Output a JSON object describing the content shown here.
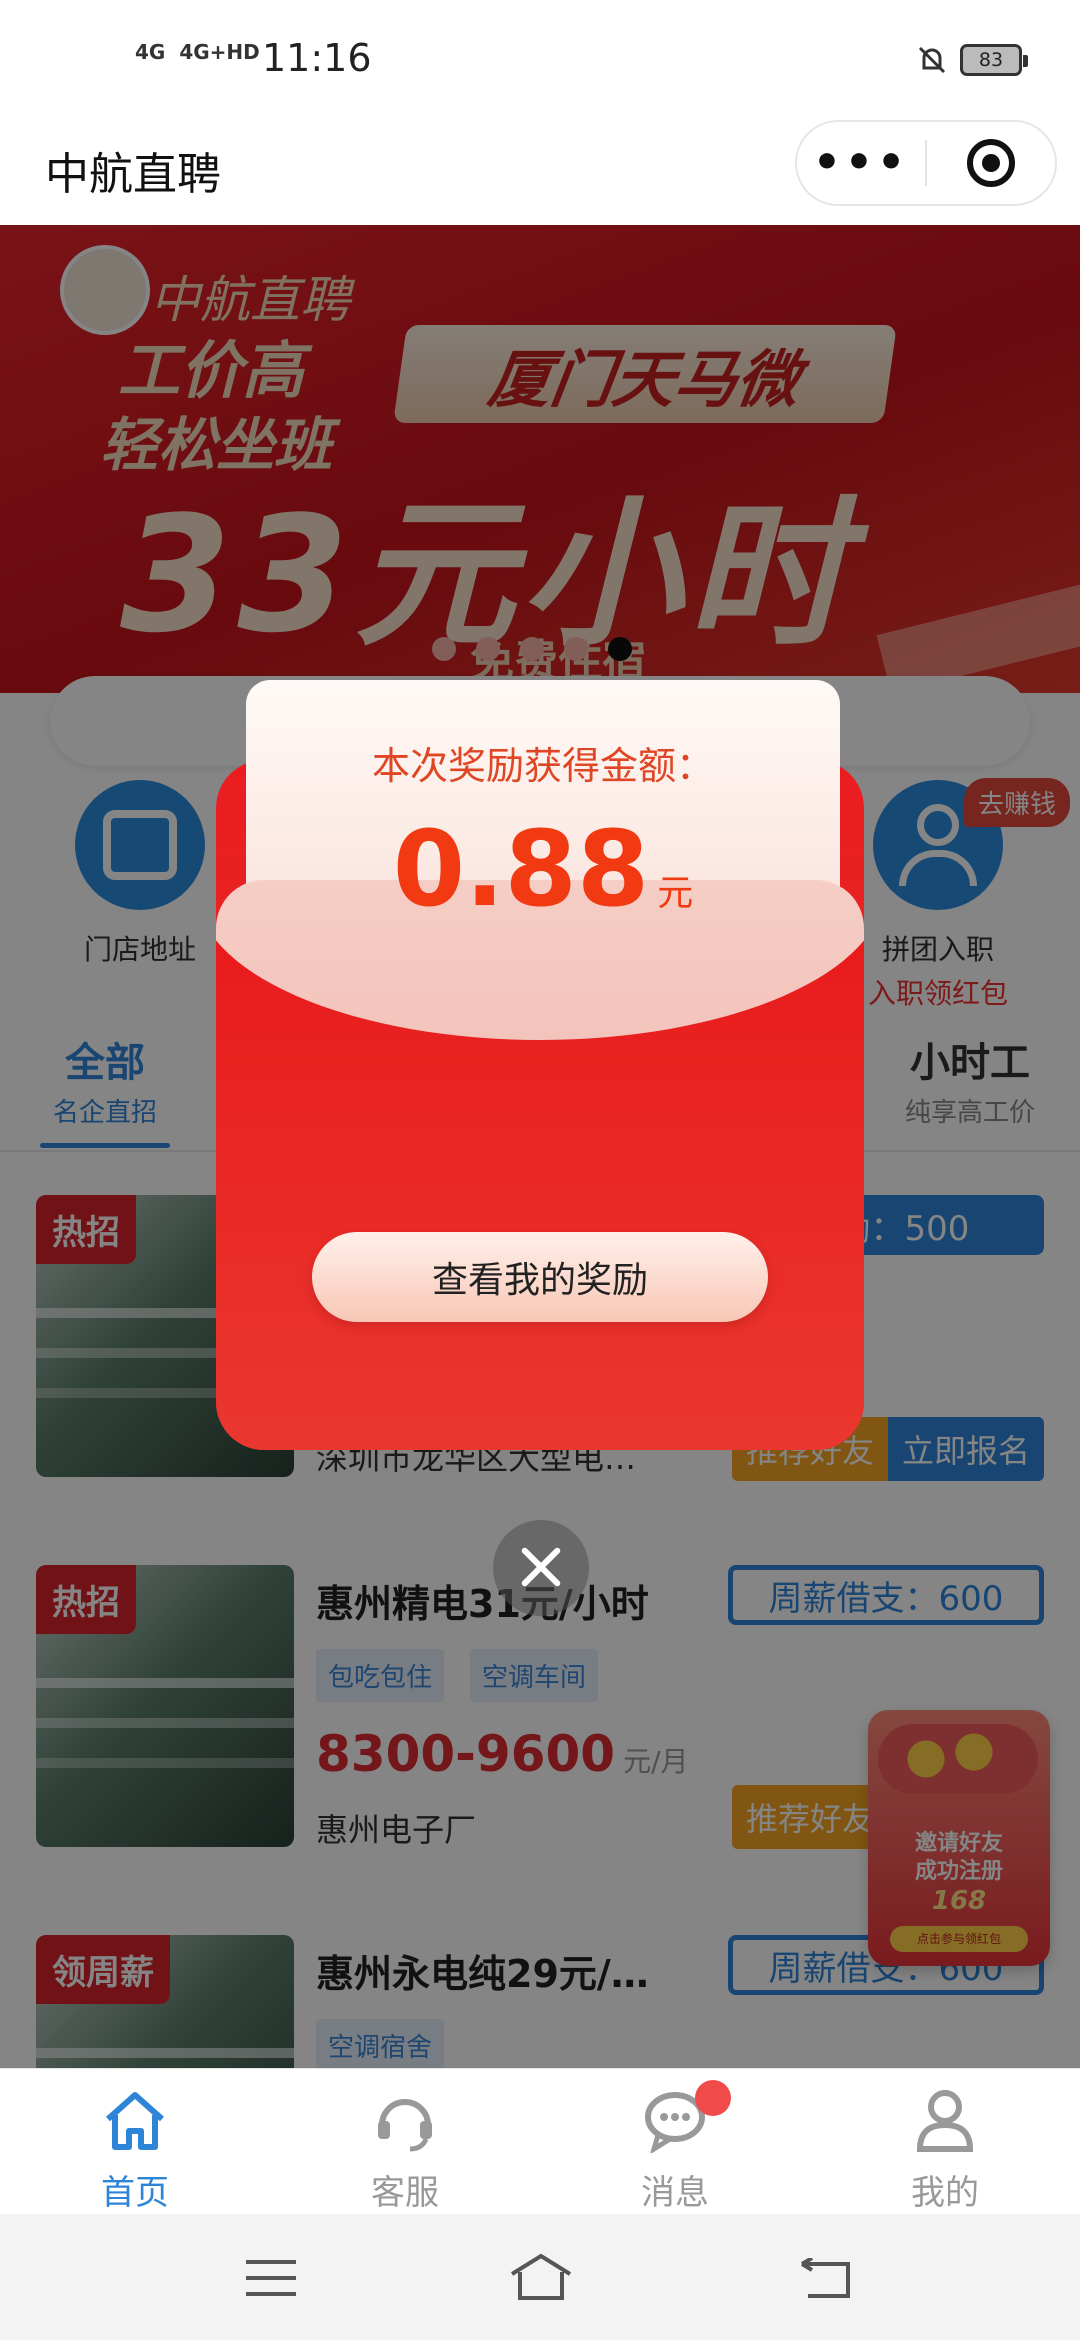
{
  "status_bar": {
    "network_1": "4G",
    "network_2": "4G+HD",
    "time": "11:16",
    "battery": "83",
    "mute_icon": "bell-off-icon"
  },
  "title_bar": {
    "title": "中航直聘",
    "more_label": "•••",
    "target_icon": "target-icon"
  },
  "banner": {
    "brand": "中航直聘",
    "line1": "工价高",
    "line2": "轻松坐班",
    "place": "厦门天马微",
    "headline": "33元小时",
    "sub": "免费住宿",
    "dot_count": 5,
    "active_dot": 4
  },
  "quick_links": [
    {
      "label": "门店地址",
      "icon": "store-icon"
    },
    {
      "label": "拼团入职",
      "sublabel": "入职领红包",
      "icon": "user-icon",
      "badge": "去赚钱"
    }
  ],
  "tabs": [
    {
      "title": "全部",
      "subtitle": "名企直招",
      "active": true
    },
    {
      "title": "小时工",
      "subtitle": "纯享高工价",
      "active": false
    }
  ],
  "jobs": [
    {
      "badge": "热招",
      "title": "",
      "company": "深圳市龙华区大型电…",
      "pill": "奖励：500",
      "pill_filled": true,
      "refer": "推荐好友",
      "apply": "立即报名"
    },
    {
      "badge": "热招",
      "title": "惠州精电31元/小时",
      "tags": [
        "包吃包住",
        "空调车间"
      ],
      "salary": "8300-9600",
      "salary_unit": "元/月",
      "company": "惠州电子厂",
      "pill": "周薪借支：600",
      "refer": "推荐好友"
    },
    {
      "badge": "领周薪",
      "title": "惠州永电纯29元/…",
      "tags": [
        "空调宿舍"
      ],
      "pill": "周薪借支：600"
    }
  ],
  "invite": {
    "line1": "邀请好友",
    "line2": "成功注册",
    "amount": "168",
    "cta": "点击参与领红包"
  },
  "bottom_nav": [
    {
      "label": "首页",
      "icon": "home-icon",
      "active": true
    },
    {
      "label": "客服",
      "icon": "headset-icon",
      "active": false
    },
    {
      "label": "消息",
      "icon": "chat-icon",
      "active": false,
      "has_dot": true
    },
    {
      "label": "我的",
      "icon": "user-icon",
      "active": false
    }
  ],
  "modal": {
    "title": "本次奖励获得金额：",
    "amount": "0.88",
    "unit": "元",
    "button": "查看我的奖励",
    "close_icon": "close-icon"
  },
  "colors": {
    "accent": "#2e85d8",
    "red": "#e91b1c",
    "orange": "#f5a623"
  }
}
